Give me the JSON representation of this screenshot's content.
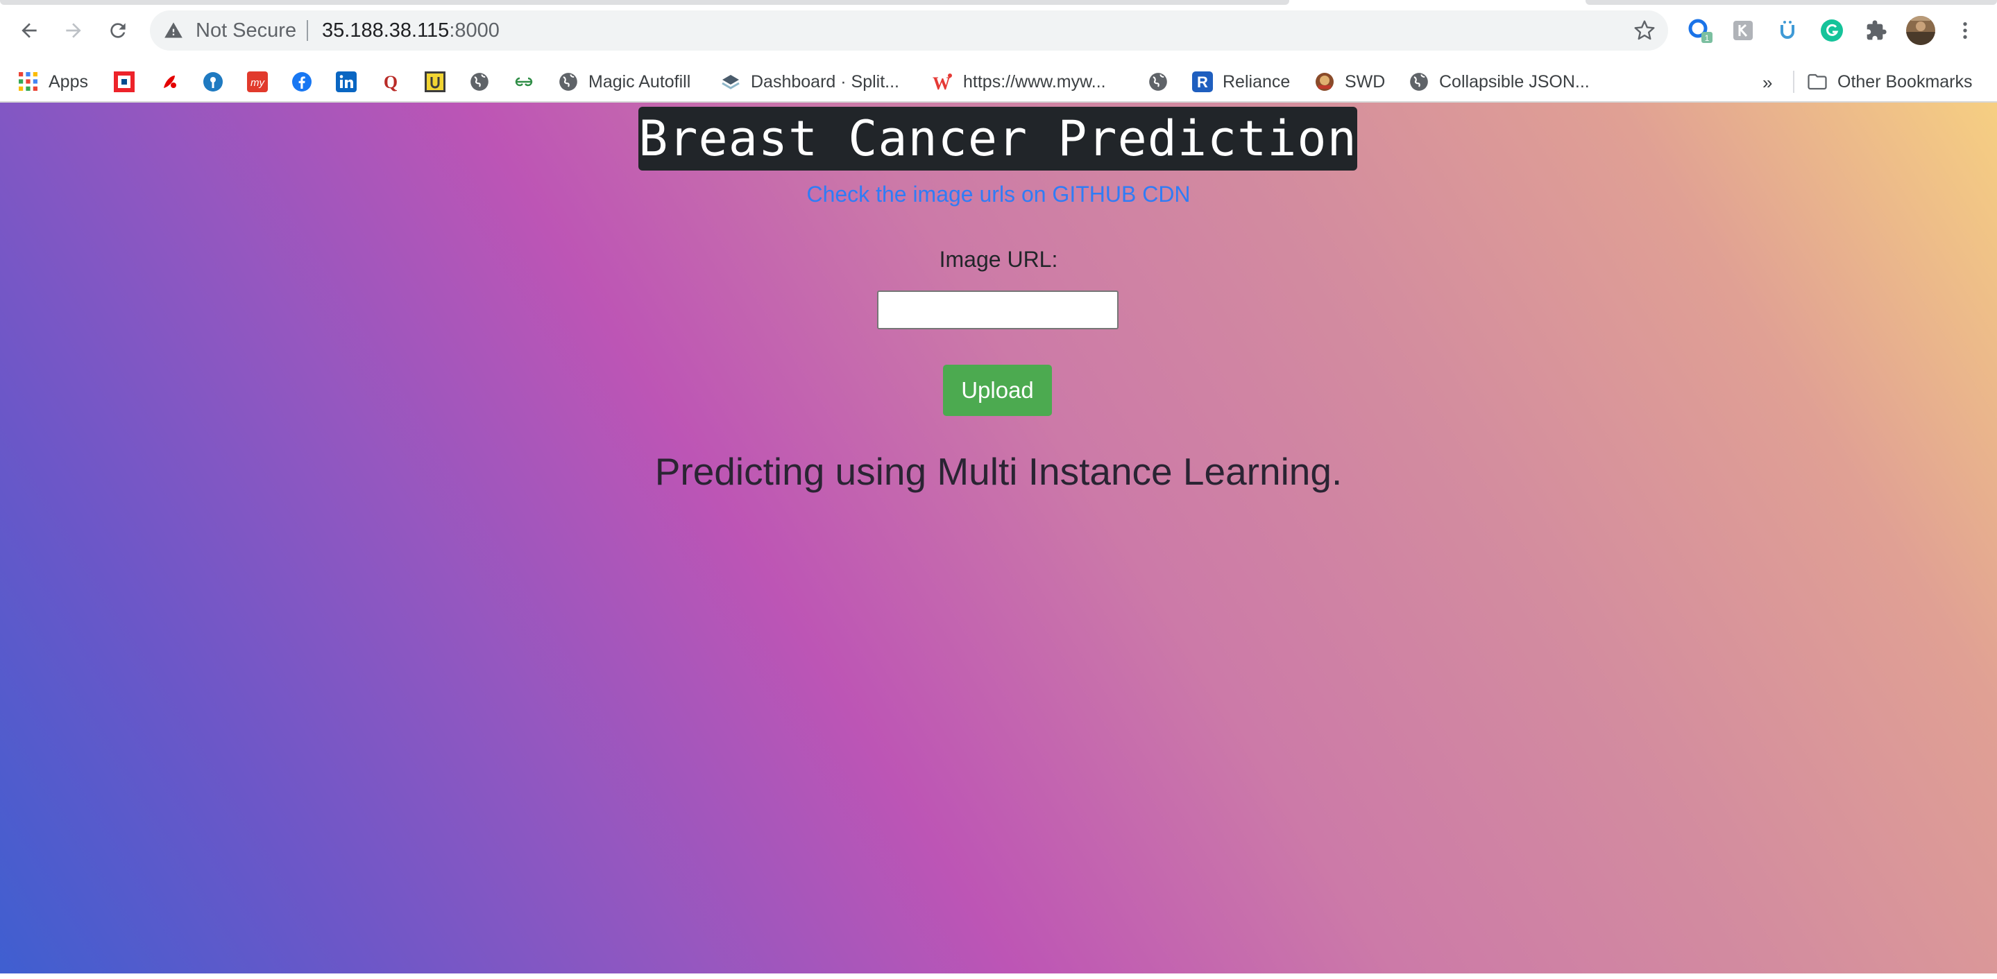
{
  "browser": {
    "security_label": "Not Secure",
    "url_host": "35.188.38.115",
    "url_port": ":8000",
    "icons": {
      "back": "arrow-left-icon",
      "forward": "arrow-right-icon",
      "reload": "reload-icon",
      "warning": "warning-triangle-icon",
      "bookmark_star": "star-icon",
      "extensions": [
        "chrome-sync-icon",
        "extension-icon",
        "extension-icon",
        "grammarly-icon",
        "puzzle-icon",
        "profile-avatar",
        "kebab-menu-icon"
      ]
    },
    "extension_badge": "1"
  },
  "bookmarks": {
    "items": [
      {
        "label": "Apps",
        "icon": "apps-grid-icon"
      },
      {
        "label": "",
        "icon": "hdfc-icon"
      },
      {
        "label": "",
        "icon": "airtel-icon"
      },
      {
        "label": "",
        "icon": "sbi-icon"
      },
      {
        "label": "",
        "icon": "mi-icon"
      },
      {
        "label": "",
        "icon": "facebook-icon"
      },
      {
        "label": "",
        "icon": "linkedin-icon"
      },
      {
        "label": "",
        "icon": "quora-icon"
      },
      {
        "label": "",
        "icon": "udemy-icon"
      },
      {
        "label": "",
        "icon": "globe-icon"
      },
      {
        "label": "",
        "icon": "geeksforgeeks-icon"
      },
      {
        "label": "Magic Autofill",
        "icon": "globe-icon"
      },
      {
        "label": "Dashboard · Split...",
        "icon": "dashboard-icon"
      },
      {
        "label": "https://www.myw...",
        "icon": "w-icon"
      },
      {
        "label": "",
        "icon": "globe-icon"
      },
      {
        "label": "Reliance",
        "icon": "r-icon"
      },
      {
        "label": "SWD",
        "icon": "swd-icon"
      },
      {
        "label": "Collapsible JSON...",
        "icon": "globe-icon"
      }
    ],
    "overflow_label": "»",
    "other_label": "Other Bookmarks"
  },
  "page": {
    "title": "Breast Cancer Prediction",
    "cdn_link": "Check the image urls on GITHUB CDN",
    "image_url_label": "Image URL:",
    "image_url_value": "",
    "upload_label": "Upload",
    "tagline": "Predicting using Multi Instance Learning."
  },
  "colors": {
    "title_bg": "#212529",
    "link": "#2f7cf6",
    "upload_bg": "#4caa50",
    "gradient": [
      "#3f5fd0",
      "#bd55b5",
      "#f6cf82"
    ]
  }
}
